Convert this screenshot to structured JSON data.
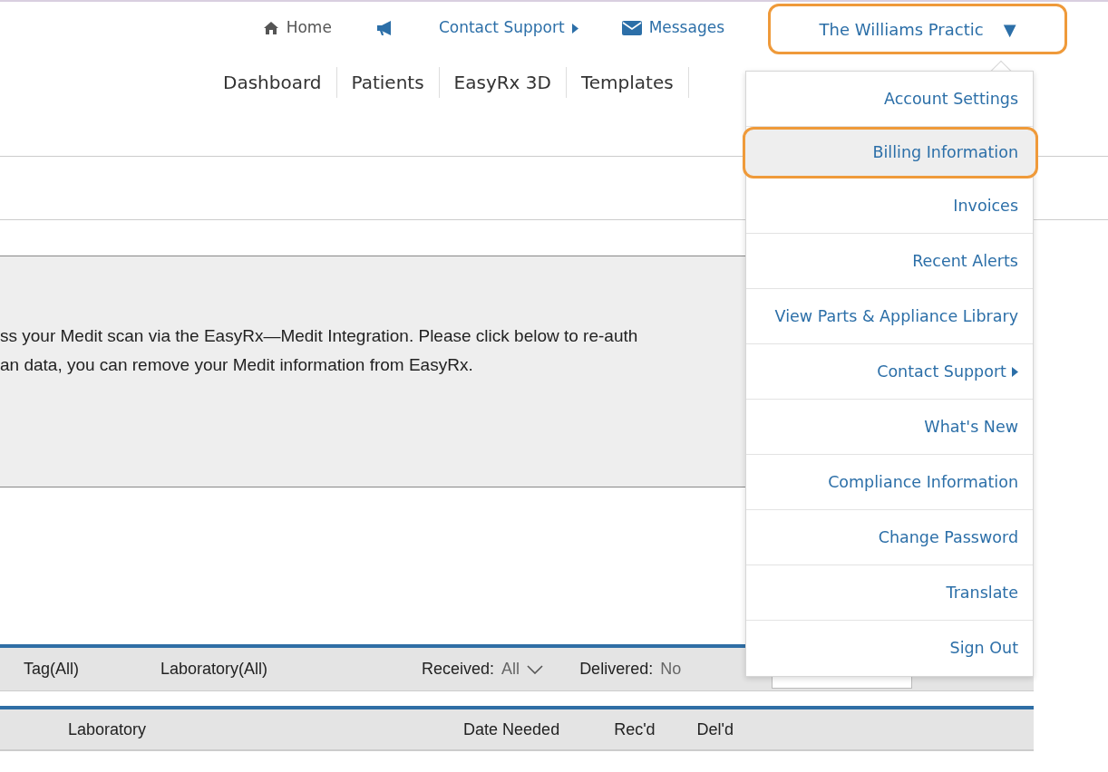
{
  "top_nav": [
    {
      "kind": "home",
      "label": "Home"
    },
    {
      "kind": "announce"
    },
    {
      "kind": "submenu",
      "label": "Contact Support"
    },
    {
      "kind": "mail",
      "label": "Messages"
    }
  ],
  "user_menu": {
    "label": "The Williams Practic",
    "caret": "▼",
    "highlighted": true
  },
  "tabs": [
    {
      "label": "Dashboard"
    },
    {
      "label": "Patients"
    },
    {
      "label": "EasyRx 3D"
    },
    {
      "label": "Templates"
    }
  ],
  "notice": {
    "lines": [
      "ss your Medit scan via the EasyRx—Medit Integration. Please click below to re-auth",
      "an data, you can remove your Medit information from EasyRx."
    ]
  },
  "filters": [
    {
      "kind": "plain",
      "label": "Tag(All)"
    },
    {
      "kind": "plain",
      "label": "Laboratory(All)"
    },
    {
      "kind": "select",
      "label": "Received:",
      "value": "All"
    },
    {
      "kind": "value",
      "label": "Delivered:",
      "value": "No"
    },
    {
      "kind": "search"
    }
  ],
  "table": {
    "columns": [
      "Laboratory",
      "Date Needed",
      "Rec'd",
      "Del'd"
    ]
  },
  "dropdown": {
    "items": [
      {
        "label": "Account Settings",
        "selected": false,
        "highlighted": false
      },
      {
        "label": "Billing Information",
        "selected": true,
        "highlighted": true
      },
      {
        "label": "Invoices",
        "selected": false,
        "highlighted": false
      },
      {
        "label": "Recent Alerts",
        "selected": false,
        "highlighted": false
      },
      {
        "label": "View Parts & Appliance Library",
        "selected": false,
        "highlighted": false
      },
      {
        "label": "Contact Support",
        "selected": false,
        "highlighted": false,
        "submenu": true
      },
      {
        "label": "What's New",
        "selected": false,
        "highlighted": false
      },
      {
        "label": "Compliance Information",
        "selected": false,
        "highlighted": false
      },
      {
        "label": "Change Password",
        "selected": false,
        "highlighted": false
      },
      {
        "label": "Translate",
        "selected": false,
        "highlighted": false
      },
      {
        "label": "Sign Out",
        "selected": false,
        "highlighted": false
      }
    ]
  }
}
